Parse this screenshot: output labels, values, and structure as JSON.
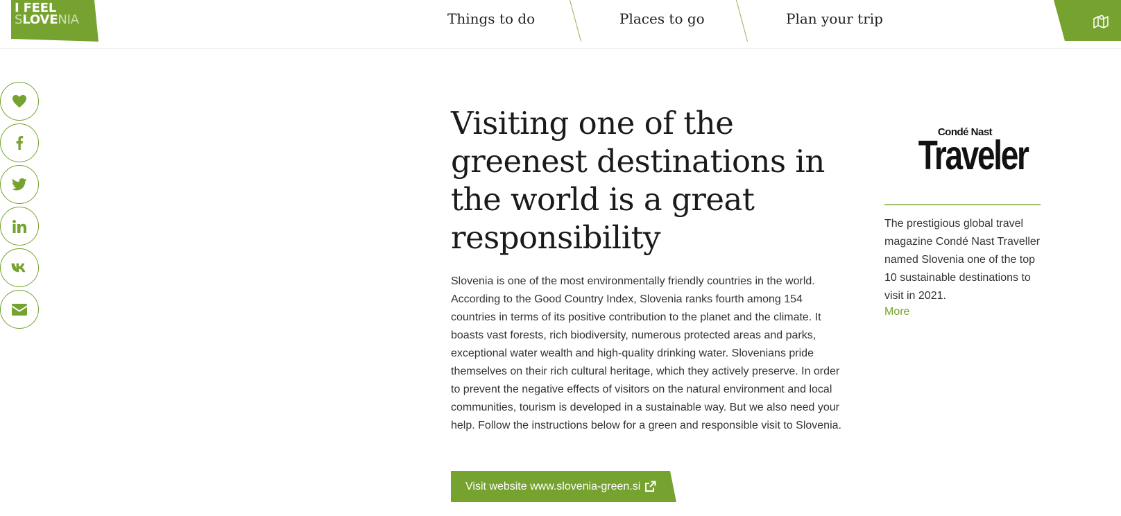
{
  "header": {
    "logo": {
      "line1": "I FEEL",
      "line2_strong": "SLOVE",
      "line2_light": "NIA",
      "line2_s": "S"
    },
    "nav": [
      {
        "label": "Things to do"
      },
      {
        "label": "Places to go"
      },
      {
        "label": "Plan your trip"
      }
    ],
    "map_icon": "map-icon"
  },
  "share": {
    "buttons": [
      {
        "icon": "heart-icon"
      },
      {
        "icon": "facebook-icon"
      },
      {
        "icon": "twitter-icon"
      },
      {
        "icon": "linkedin-icon"
      },
      {
        "icon": "vk-icon"
      },
      {
        "icon": "envelope-icon"
      }
    ]
  },
  "main": {
    "headline": "Visiting one of the greenest destinations in the world is a great responsibility",
    "intro": "Slovenia is one of the most environmentally friendly countries in the world. According to the Good Country Index, Slovenia ranks fourth among 154 countries in terms of its positive contribution to the planet and the climate. It boasts vast forests, rich biodiversity, numerous protected areas and parks, exceptional water wealth and high-quality drinking water. Slovenians pride themselves on their rich cultural heritage, which they actively preserve. In order to prevent the negative effects of visitors on the natural environment and local communities, tourism is developed in a sustainable way. But we also need your help. Follow the instructions below for a green and responsible visit to Slovenia.",
    "cta_label": "Visit website www.slovenia-green.si",
    "cta_icon": "external-link-icon"
  },
  "aside": {
    "logo_small": "Condé Nast",
    "logo_big": "Traveler",
    "text": "The prestigious global travel magazine Condé Nast Traveller named Slovenia one of the top 10 sustainable destinations to visit in 2021.",
    "more_label": "More"
  },
  "colors": {
    "accent": "#76a22f",
    "text": "#333333",
    "heading": "#1a1a1a"
  }
}
